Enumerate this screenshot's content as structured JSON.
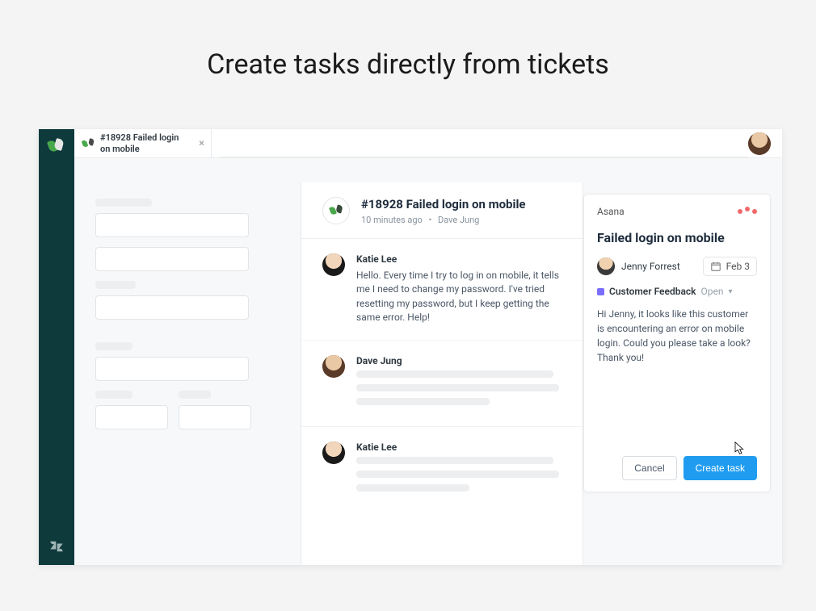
{
  "hero": "Create tasks directly from tickets",
  "tab": {
    "title": "#18928 Failed login on mobile"
  },
  "ticket": {
    "title": "#18928 Failed login on mobile",
    "age": "10 minutes ago",
    "author": "Dave Jung"
  },
  "messages": [
    {
      "name": "Katie Lee",
      "body": "Hello. Every time I try to log in on mobile, it tells me I need to change my password. I've tried resetting my password, but I keep getting the same error. Help!"
    },
    {
      "name": "Dave Jung"
    },
    {
      "name": "Katie Lee"
    }
  ],
  "asana": {
    "brand": "Asana",
    "title": "Failed login on mobile",
    "assignee": "Jenny Forrest",
    "due": "Feb 3",
    "project": "Customer Feedback",
    "status": "Open",
    "description": "Hi Jenny, it looks like this customer is encountering an error on mobile login. Could you please take a look? Thank you!",
    "cancel": "Cancel",
    "create": "Create task"
  }
}
